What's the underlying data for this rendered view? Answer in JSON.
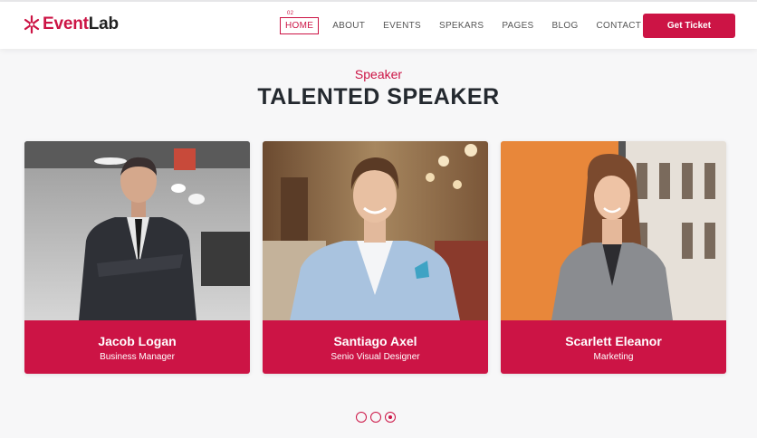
{
  "brand": {
    "name_part1": "Event",
    "name_part2": "Lab",
    "accent": "#cc1445"
  },
  "nav": {
    "active_number": "02",
    "items": [
      {
        "label": "HOME",
        "active": true
      },
      {
        "label": "ABOUT"
      },
      {
        "label": "EVENTS"
      },
      {
        "label": "SPEKARS"
      },
      {
        "label": "PAGES"
      },
      {
        "label": "BLOG"
      },
      {
        "label": "CONTACT"
      }
    ]
  },
  "cta": {
    "label": "Get Ticket"
  },
  "section": {
    "subtitle": "Speaker",
    "title": "TALENTED SPEAKER"
  },
  "speakers": [
    {
      "name": "Jacob Logan",
      "role": "Business Manager"
    },
    {
      "name": "Santiago Axel",
      "role": "Senio Visual Designer"
    },
    {
      "name": "Scarlett Eleanor",
      "role": "Marketing"
    }
  ],
  "carousel": {
    "count": 3,
    "active_index": 2
  },
  "colors": {
    "primary": "#cc1445",
    "heading": "#24292f",
    "background": "#f7f7f8"
  }
}
